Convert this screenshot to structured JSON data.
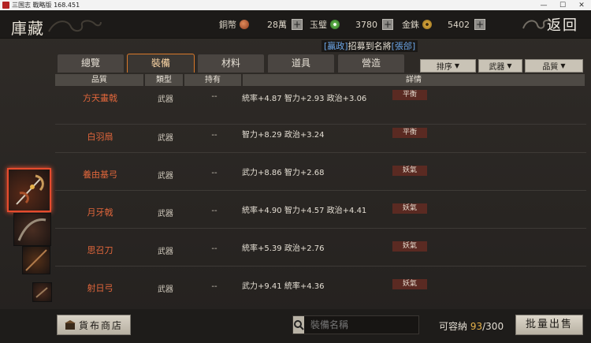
{
  "window": {
    "title": "三国志 戰略版 168.451"
  },
  "header": {
    "title": "庫藏",
    "back_label": "返回",
    "currencies": [
      {
        "label": "銅幣",
        "value": "28萬",
        "icon": "copper-coin-icon",
        "color": "#b4532e"
      },
      {
        "label": "玉璧",
        "value": "3780",
        "icon": "jade-icon",
        "color": "#5fb04a"
      },
      {
        "label": "金銖",
        "value": "5402",
        "icon": "gold-coin-icon",
        "color": "#d6a43a"
      }
    ],
    "plus": "+"
  },
  "recruit": {
    "prefix": "[贏政]",
    "middle": "招募到名將",
    "suffix": "[張郃]"
  },
  "tabs": [
    "總覽",
    "裝備",
    "材料",
    "道具",
    "營造"
  ],
  "active_tab": "裝備",
  "filters": [
    "排序",
    "武器",
    "品質"
  ],
  "columns": [
    "品質",
    "類型",
    "持有",
    "詳情"
  ],
  "items": [
    {
      "name": "方天畫戟",
      "type": "武器",
      "own": "--",
      "stats": "統率+4.87  智力+2.93  政治+3.06",
      "tag": "平衡"
    },
    {
      "name": "白羽扇",
      "type": "武器",
      "own": "--",
      "stats": "智力+8.29  政治+3.24",
      "tag": "平衡"
    },
    {
      "name": "養由基弓",
      "type": "武器",
      "own": "--",
      "stats": "武力+8.86  智力+2.68",
      "tag": "妖氣"
    },
    {
      "name": "月牙戟",
      "type": "武器",
      "own": "--",
      "stats": "統率+4.90  智力+4.57  政治+4.41",
      "tag": "妖氣"
    },
    {
      "name": "思召刀",
      "type": "武器",
      "own": "--",
      "stats": "統率+5.39  政治+2.76",
      "tag": "妖氣"
    },
    {
      "name": "射日弓",
      "type": "武器",
      "own": "--",
      "stats": "武力+9.41  統率+4.36",
      "tag": "妖氣"
    }
  ],
  "footer": {
    "shop_label": "貨布商店",
    "search_placeholder": "裝備名稱",
    "capacity_label": "可容納",
    "capacity_used": "93",
    "capacity_total": "/300",
    "bulk_sell_label": "批量出售"
  }
}
